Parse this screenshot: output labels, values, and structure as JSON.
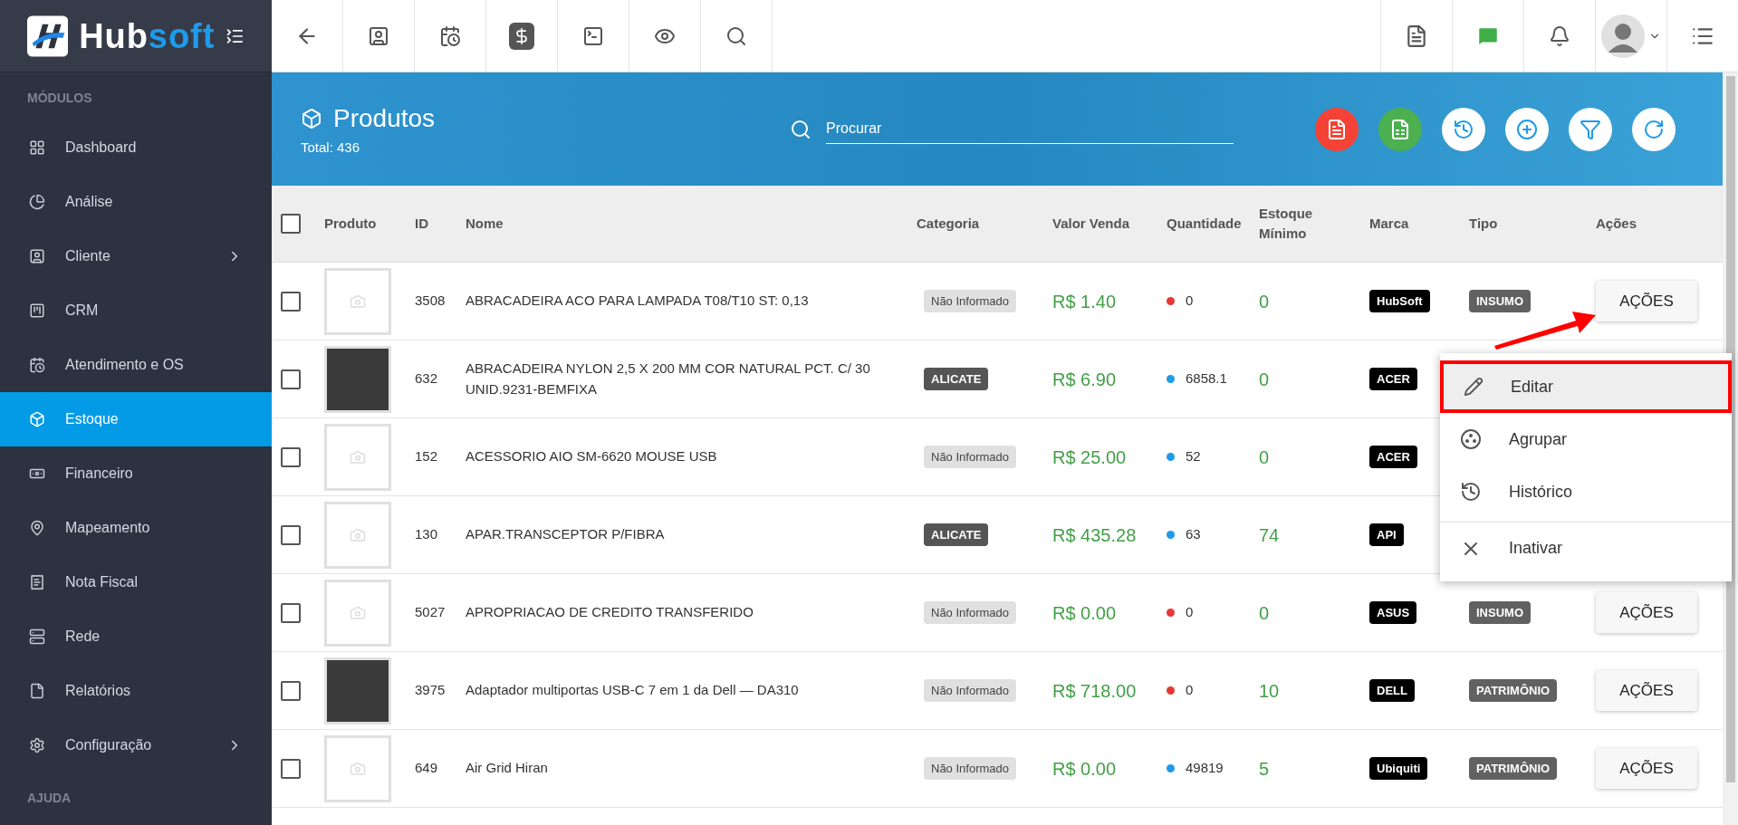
{
  "sidebar": {
    "logo": {
      "part_1": "Hub",
      "part_2": "soft"
    },
    "sections": [
      {
        "title": "MÓDULOS",
        "items": [
          {
            "label": "Dashboard",
            "selected": false,
            "submenu": false
          },
          {
            "label": "Análise",
            "selected": false,
            "submenu": false
          },
          {
            "label": "Cliente",
            "selected": false,
            "submenu": true
          },
          {
            "label": "CRM",
            "selected": false,
            "submenu": false
          },
          {
            "label": "Atendimento e OS",
            "selected": false,
            "submenu": false
          },
          {
            "label": "Estoque",
            "selected": true,
            "submenu": false
          },
          {
            "label": "Financeiro",
            "selected": false,
            "submenu": false
          },
          {
            "label": "Mapeamento",
            "selected": false,
            "submenu": false
          },
          {
            "label": "Nota Fiscal",
            "selected": false,
            "submenu": false
          },
          {
            "label": "Rede",
            "selected": false,
            "submenu": false
          },
          {
            "label": "Relatórios",
            "selected": false,
            "submenu": false
          },
          {
            "label": "Configuração",
            "selected": false,
            "submenu": true
          }
        ]
      },
      {
        "title": "AJUDA"
      }
    ]
  },
  "header": {
    "title": "Produtos",
    "total": "Total: 436",
    "search": {
      "placeholder": "Procurar"
    }
  },
  "table": {
    "select_all_checked": false,
    "columns": [
      "Produto",
      "ID",
      "Nome",
      "Categoria",
      "Valor Venda",
      "Quantidade",
      "Estoque Mínimo",
      "Marca",
      "Tipo",
      "Ações"
    ],
    "rows": [
      {
        "checked": false,
        "thumbnail": {
          "kind": "placeholder"
        },
        "id": "3508",
        "name": "ABRACADEIRA ACO PARA LAMPADA T08/T10 ST: 0,13",
        "category": {
          "label": "Não Informado",
          "kind": "plain"
        },
        "price": "R$ 1.40",
        "quantity": {
          "value": "0",
          "color": "#e53935"
        },
        "min_stock": "0",
        "brand": "HubSoft",
        "type": "INSUMO",
        "action": "AÇÕES"
      },
      {
        "checked": false,
        "thumbnail": {
          "kind": "photo"
        },
        "id": "632",
        "name": "ABRACADEIRA NYLON 2,5 X 200 MM COR NATURAL PCT. C/ 30 UNID.9231-BEMFIXA",
        "category": {
          "label": "ALICATE",
          "kind": "dark"
        },
        "price": "R$ 6.90",
        "quantity": {
          "value": "6858.1",
          "color": "#1e9be9"
        },
        "min_stock": "0",
        "brand": "ACER"
      },
      {
        "checked": false,
        "thumbnail": {
          "kind": "placeholder"
        },
        "id": "152",
        "name": "ACESSORIO AIO SM-6620 MOUSE USB",
        "category": {
          "label": "Não Informado",
          "kind": "plain"
        },
        "price": "R$ 25.00",
        "quantity": {
          "value": "52",
          "color": "#1e9be9"
        },
        "min_stock": "0",
        "brand": "ACER"
      },
      {
        "checked": false,
        "thumbnail": {
          "kind": "placeholder"
        },
        "id": "130",
        "name": "APAR.TRANSCEPTOR P/FIBRA",
        "category": {
          "label": "ALICATE",
          "kind": "dark"
        },
        "price": "R$ 435.28",
        "quantity": {
          "value": "63",
          "color": "#1e9be9"
        },
        "min_stock": "74",
        "brand": "API"
      },
      {
        "checked": false,
        "thumbnail": {
          "kind": "placeholder"
        },
        "id": "5027",
        "name": "APROPRIACAO DE CREDITO TRANSFERIDO",
        "category": {
          "label": "Não Informado",
          "kind": "plain"
        },
        "price": "R$ 0.00",
        "quantity": {
          "value": "0",
          "color": "#e53935"
        },
        "min_stock": "0",
        "brand": "ASUS",
        "type": "INSUMO",
        "action": "AÇÕES"
      },
      {
        "checked": false,
        "thumbnail": {
          "kind": "photo"
        },
        "id": "3975",
        "name": "Adaptador multiportas USB-C 7 em 1 da Dell — DA310",
        "category": {
          "label": "Não Informado",
          "kind": "plain"
        },
        "price": "R$ 718.00",
        "quantity": {
          "value": "0",
          "color": "#e53935"
        },
        "min_stock": "10",
        "brand": "DELL",
        "type": "PATRIMÔNIO",
        "action": "AÇÕES"
      },
      {
        "checked": false,
        "thumbnail": {
          "kind": "placeholder"
        },
        "id": "649",
        "name": "Air Grid Hiran",
        "category": {
          "label": "Não Informado",
          "kind": "plain"
        },
        "price": "R$ 0.00",
        "quantity": {
          "value": "49819",
          "color": "#1e9be9"
        },
        "min_stock": "5",
        "brand": "Ubiquiti",
        "type": "PATRIMÔNIO",
        "action": "AÇÕES"
      }
    ]
  },
  "menu": {
    "items": [
      {
        "label": "Editar",
        "kind": "edit",
        "selected": true,
        "divider_before": false
      },
      {
        "label": "Agrupar",
        "kind": "group",
        "selected": false,
        "divider_before": false
      },
      {
        "label": "Histórico",
        "kind": "history",
        "selected": false,
        "divider_before": false
      },
      {
        "label": "Inativar",
        "kind": "deactivate",
        "selected": false,
        "divider_before": true
      }
    ]
  }
}
